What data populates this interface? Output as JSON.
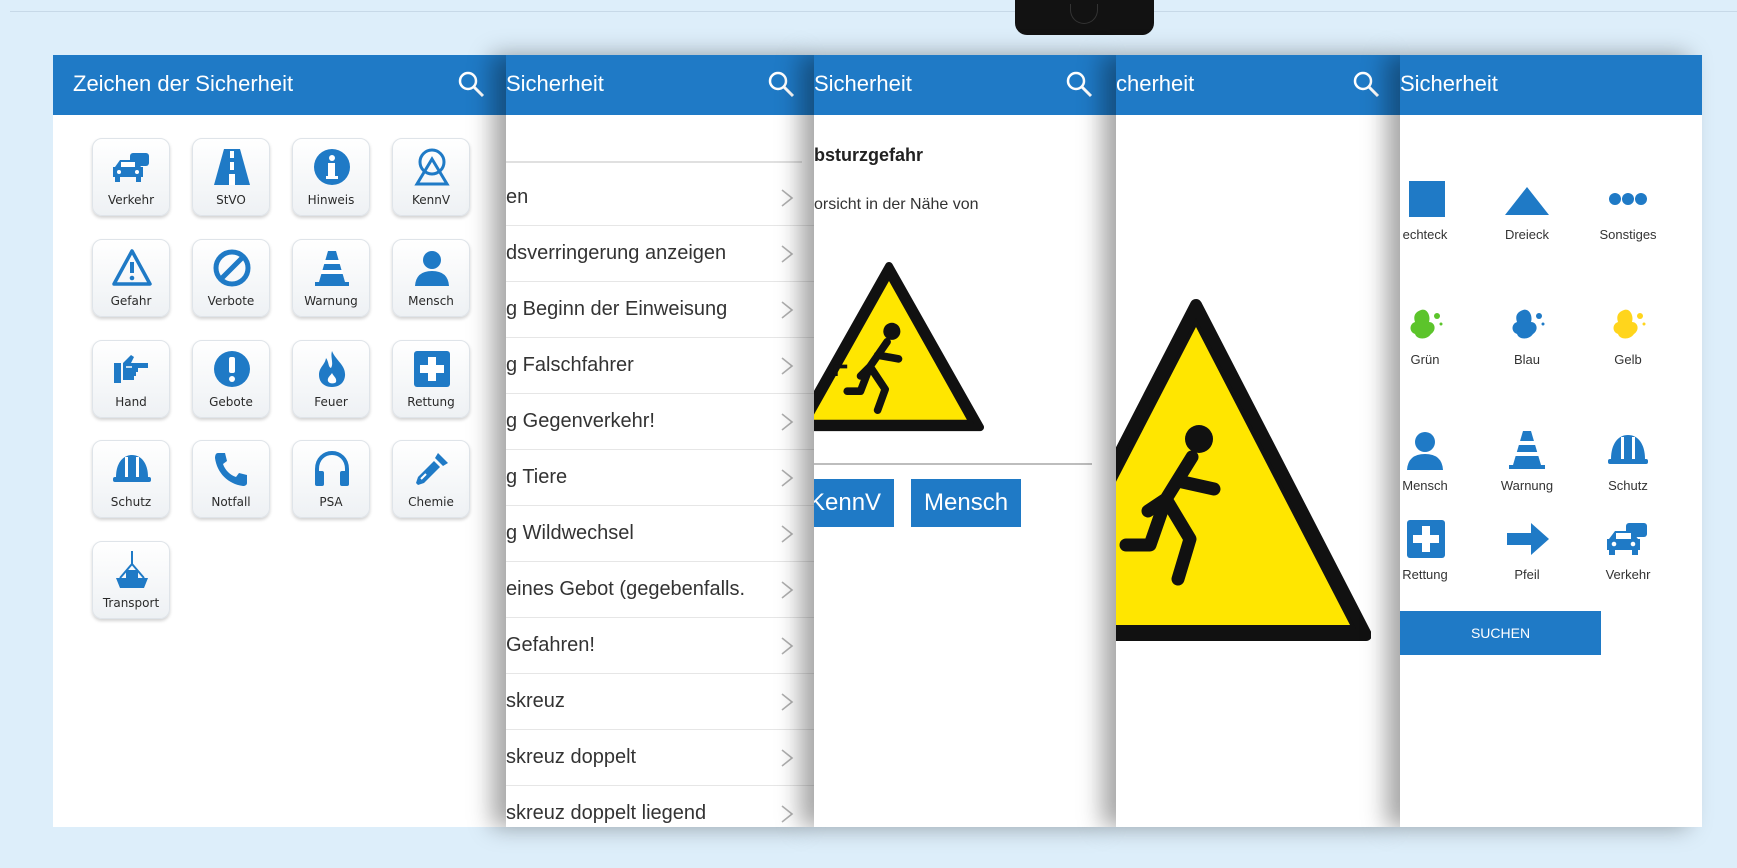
{
  "colors": {
    "app_bar": "#1f7ac6",
    "icon_blue": "#1f7ac6",
    "background": "#ddeefa",
    "warning_yellow": "#ffe600"
  },
  "screens": {
    "categories": {
      "title": "Zeichen der Sicherheit",
      "items": [
        {
          "label": "Verkehr",
          "icon": "car-icon"
        },
        {
          "label": "StVO",
          "icon": "road-icon"
        },
        {
          "label": "Hinweis",
          "icon": "info-icon"
        },
        {
          "label": "KennV",
          "icon": "kennv-icon"
        },
        {
          "label": "Gefahr",
          "icon": "warning-triangle-icon"
        },
        {
          "label": "Verbote",
          "icon": "prohibition-icon"
        },
        {
          "label": "Warnung",
          "icon": "traffic-cone-icon"
        },
        {
          "label": "Mensch",
          "icon": "person-icon"
        },
        {
          "label": "Hand",
          "icon": "pointing-hand-icon"
        },
        {
          "label": "Gebote",
          "icon": "exclamation-icon"
        },
        {
          "label": "Feuer",
          "icon": "fire-icon"
        },
        {
          "label": "Rettung",
          "icon": "first-aid-icon"
        },
        {
          "label": "Schutz",
          "icon": "hard-hat-icon"
        },
        {
          "label": "Notfall",
          "icon": "phone-icon"
        },
        {
          "label": "PSA",
          "icon": "headphones-icon"
        },
        {
          "label": "Chemie",
          "icon": "pipette-icon"
        },
        {
          "label": "Transport",
          "icon": "crane-hook-icon"
        }
      ]
    },
    "list": {
      "title": "Sicherheit",
      "rows": [
        "en",
        "dsverringerung anzeigen",
        "g Beginn der Einweisung",
        "g Falschfahrer",
        "g Gegenverkehr!",
        "g Tiere",
        "g Wildwechsel",
        "eines Gebot (gegebenfalls...",
        "Gefahren!",
        "skreuz",
        "skreuz doppelt",
        "skreuz doppelt liegend"
      ]
    },
    "detail": {
      "title": "Sicherheit",
      "heading": "bsturzgefahr",
      "description": "orsicht in der Nähe von",
      "tags": [
        "KennV",
        "Mensch"
      ]
    },
    "sign": {
      "title": "cherheit"
    },
    "filter": {
      "title": "Sicherheit",
      "shapes": [
        {
          "label": "echteck",
          "icon": "square-icon"
        },
        {
          "label": "Dreieck",
          "icon": "triangle-icon"
        },
        {
          "label": "Sonstiges",
          "icon": "dots-icon"
        }
      ],
      "colors": [
        {
          "label": "Grün",
          "icon": "paint-splash-green-icon"
        },
        {
          "label": "Blau",
          "icon": "paint-splash-blue-icon"
        },
        {
          "label": "Gelb",
          "icon": "paint-splash-yellow-icon"
        }
      ],
      "categories_row1": [
        {
          "label": "Mensch",
          "icon": "person-icon"
        },
        {
          "label": "Warnung",
          "icon": "traffic-cone-icon"
        },
        {
          "label": "Schutz",
          "icon": "hard-hat-icon"
        }
      ],
      "categories_row2": [
        {
          "label": "Rettung",
          "icon": "first-aid-icon"
        },
        {
          "label": "Pfeil",
          "icon": "arrow-icon"
        },
        {
          "label": "Verkehr",
          "icon": "car-icon"
        }
      ],
      "button": "SUCHEN"
    }
  }
}
